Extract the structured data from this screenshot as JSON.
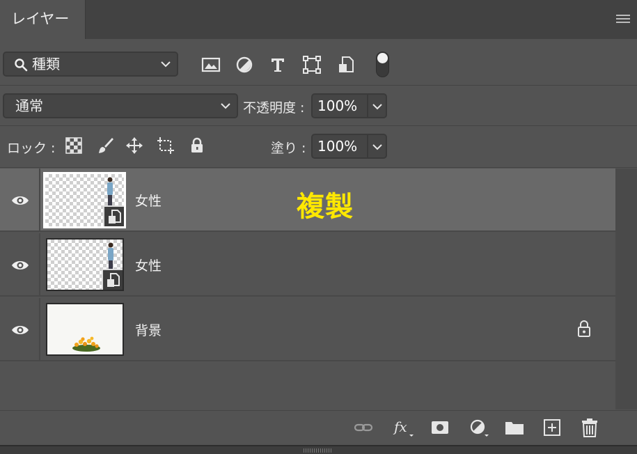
{
  "panel": {
    "tab_title": "レイヤー"
  },
  "filter": {
    "kind_label": "種類"
  },
  "blend": {
    "mode": "通常",
    "opacity_label": "不透明度 :",
    "opacity_value": "100%"
  },
  "lock": {
    "label": "ロック :",
    "fill_label": "塗り :",
    "fill_value": "100%"
  },
  "layers": [
    {
      "name": "女性",
      "selected": true,
      "type": "smart-object",
      "annotation": "複製"
    },
    {
      "name": "女性",
      "selected": false,
      "type": "smart-object"
    },
    {
      "name": "背景",
      "selected": false,
      "type": "background",
      "locked": true
    }
  ],
  "colors": {
    "panel_bg": "#535353",
    "selected_row": "#696969",
    "annotation": "#ffe800"
  },
  "icons": {
    "filter_bar": [
      "search-icon",
      "image-filter-icon",
      "adjustment-filter-icon",
      "type-filter-icon",
      "shape-filter-icon",
      "smart-object-filter-icon",
      "filter-toggle"
    ],
    "lock_bar": [
      "lock-transparent-icon",
      "lock-pixels-icon",
      "lock-position-icon",
      "lock-artboard-icon",
      "lock-all-icon"
    ],
    "bottom_bar": [
      "link-icon",
      "fx-icon",
      "mask-icon",
      "adjustment-layer-icon",
      "group-folder-icon",
      "new-layer-icon",
      "trash-icon"
    ]
  }
}
